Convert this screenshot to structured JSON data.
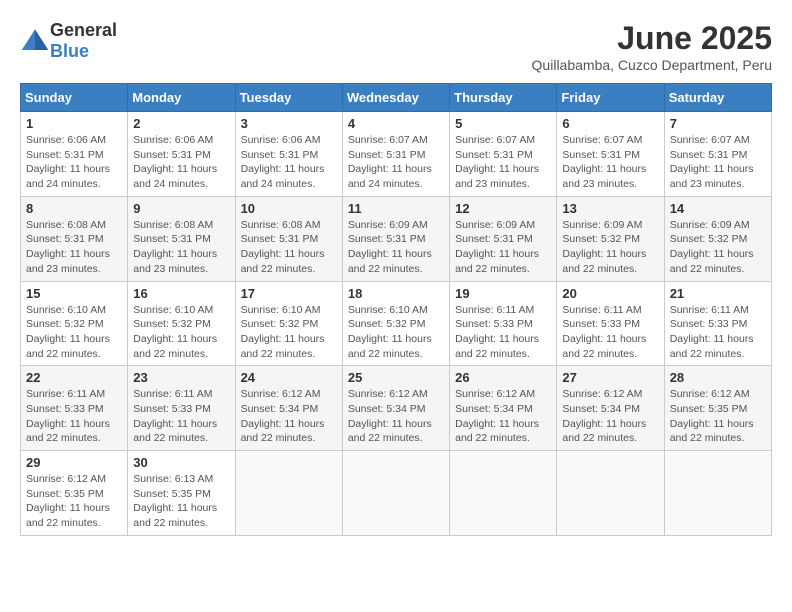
{
  "header": {
    "logo_general": "General",
    "logo_blue": "Blue",
    "month_title": "June 2025",
    "subtitle": "Quillabamba, Cuzco Department, Peru"
  },
  "days_of_week": [
    "Sunday",
    "Monday",
    "Tuesday",
    "Wednesday",
    "Thursday",
    "Friday",
    "Saturday"
  ],
  "weeks": [
    [
      {
        "day": "1",
        "info": "Sunrise: 6:06 AM\nSunset: 5:31 PM\nDaylight: 11 hours\nand 24 minutes."
      },
      {
        "day": "2",
        "info": "Sunrise: 6:06 AM\nSunset: 5:31 PM\nDaylight: 11 hours\nand 24 minutes."
      },
      {
        "day": "3",
        "info": "Sunrise: 6:06 AM\nSunset: 5:31 PM\nDaylight: 11 hours\nand 24 minutes."
      },
      {
        "day": "4",
        "info": "Sunrise: 6:07 AM\nSunset: 5:31 PM\nDaylight: 11 hours\nand 24 minutes."
      },
      {
        "day": "5",
        "info": "Sunrise: 6:07 AM\nSunset: 5:31 PM\nDaylight: 11 hours\nand 23 minutes."
      },
      {
        "day": "6",
        "info": "Sunrise: 6:07 AM\nSunset: 5:31 PM\nDaylight: 11 hours\nand 23 minutes."
      },
      {
        "day": "7",
        "info": "Sunrise: 6:07 AM\nSunset: 5:31 PM\nDaylight: 11 hours\nand 23 minutes."
      }
    ],
    [
      {
        "day": "8",
        "info": "Sunrise: 6:08 AM\nSunset: 5:31 PM\nDaylight: 11 hours\nand 23 minutes."
      },
      {
        "day": "9",
        "info": "Sunrise: 6:08 AM\nSunset: 5:31 PM\nDaylight: 11 hours\nand 23 minutes."
      },
      {
        "day": "10",
        "info": "Sunrise: 6:08 AM\nSunset: 5:31 PM\nDaylight: 11 hours\nand 22 minutes."
      },
      {
        "day": "11",
        "info": "Sunrise: 6:09 AM\nSunset: 5:31 PM\nDaylight: 11 hours\nand 22 minutes."
      },
      {
        "day": "12",
        "info": "Sunrise: 6:09 AM\nSunset: 5:31 PM\nDaylight: 11 hours\nand 22 minutes."
      },
      {
        "day": "13",
        "info": "Sunrise: 6:09 AM\nSunset: 5:32 PM\nDaylight: 11 hours\nand 22 minutes."
      },
      {
        "day": "14",
        "info": "Sunrise: 6:09 AM\nSunset: 5:32 PM\nDaylight: 11 hours\nand 22 minutes."
      }
    ],
    [
      {
        "day": "15",
        "info": "Sunrise: 6:10 AM\nSunset: 5:32 PM\nDaylight: 11 hours\nand 22 minutes."
      },
      {
        "day": "16",
        "info": "Sunrise: 6:10 AM\nSunset: 5:32 PM\nDaylight: 11 hours\nand 22 minutes."
      },
      {
        "day": "17",
        "info": "Sunrise: 6:10 AM\nSunset: 5:32 PM\nDaylight: 11 hours\nand 22 minutes."
      },
      {
        "day": "18",
        "info": "Sunrise: 6:10 AM\nSunset: 5:32 PM\nDaylight: 11 hours\nand 22 minutes."
      },
      {
        "day": "19",
        "info": "Sunrise: 6:11 AM\nSunset: 5:33 PM\nDaylight: 11 hours\nand 22 minutes."
      },
      {
        "day": "20",
        "info": "Sunrise: 6:11 AM\nSunset: 5:33 PM\nDaylight: 11 hours\nand 22 minutes."
      },
      {
        "day": "21",
        "info": "Sunrise: 6:11 AM\nSunset: 5:33 PM\nDaylight: 11 hours\nand 22 minutes."
      }
    ],
    [
      {
        "day": "22",
        "info": "Sunrise: 6:11 AM\nSunset: 5:33 PM\nDaylight: 11 hours\nand 22 minutes."
      },
      {
        "day": "23",
        "info": "Sunrise: 6:11 AM\nSunset: 5:33 PM\nDaylight: 11 hours\nand 22 minutes."
      },
      {
        "day": "24",
        "info": "Sunrise: 6:12 AM\nSunset: 5:34 PM\nDaylight: 11 hours\nand 22 minutes."
      },
      {
        "day": "25",
        "info": "Sunrise: 6:12 AM\nSunset: 5:34 PM\nDaylight: 11 hours\nand 22 minutes."
      },
      {
        "day": "26",
        "info": "Sunrise: 6:12 AM\nSunset: 5:34 PM\nDaylight: 11 hours\nand 22 minutes."
      },
      {
        "day": "27",
        "info": "Sunrise: 6:12 AM\nSunset: 5:34 PM\nDaylight: 11 hours\nand 22 minutes."
      },
      {
        "day": "28",
        "info": "Sunrise: 6:12 AM\nSunset: 5:35 PM\nDaylight: 11 hours\nand 22 minutes."
      }
    ],
    [
      {
        "day": "29",
        "info": "Sunrise: 6:12 AM\nSunset: 5:35 PM\nDaylight: 11 hours\nand 22 minutes."
      },
      {
        "day": "30",
        "info": "Sunrise: 6:13 AM\nSunset: 5:35 PM\nDaylight: 11 hours\nand 22 minutes."
      },
      {
        "day": "",
        "info": ""
      },
      {
        "day": "",
        "info": ""
      },
      {
        "day": "",
        "info": ""
      },
      {
        "day": "",
        "info": ""
      },
      {
        "day": "",
        "info": ""
      }
    ]
  ]
}
